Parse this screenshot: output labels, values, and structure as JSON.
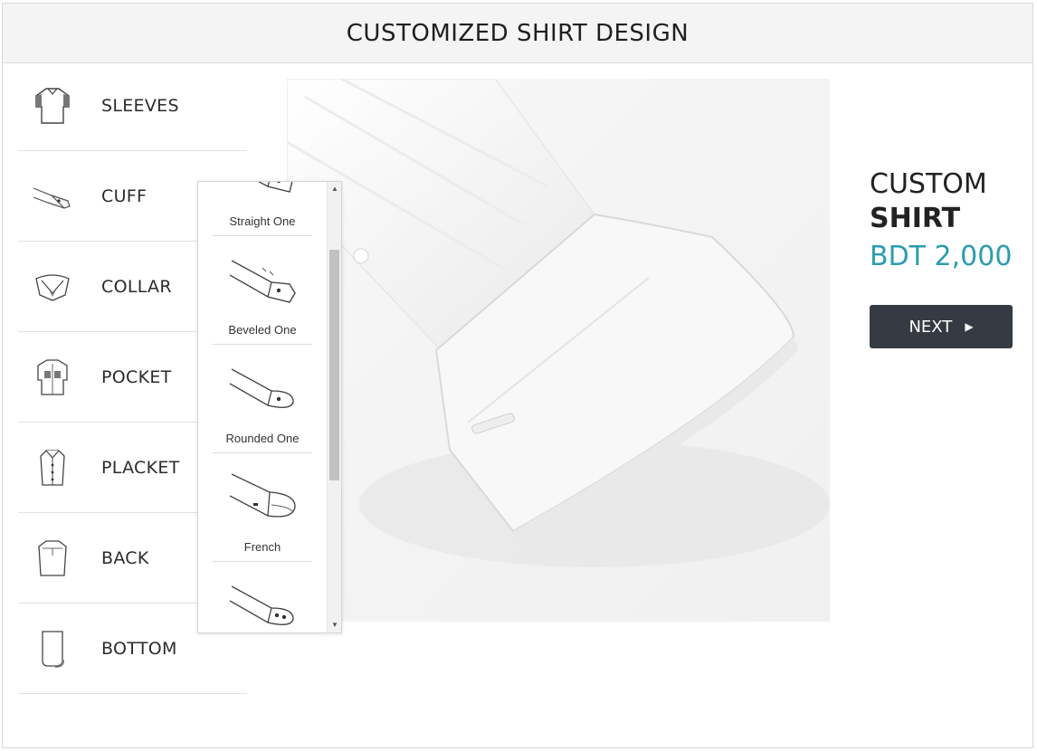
{
  "header": {
    "title": "CUSTOMIZED SHIRT DESIGN"
  },
  "menu": {
    "items": [
      {
        "label": "SLEEVES",
        "icon": "sleeves-icon"
      },
      {
        "label": "CUFF",
        "icon": "cuff-icon"
      },
      {
        "label": "COLLAR",
        "icon": "collar-icon"
      },
      {
        "label": "POCKET",
        "icon": "pocket-icon"
      },
      {
        "label": "PLACKET",
        "icon": "placket-icon"
      },
      {
        "label": "BACK",
        "icon": "back-icon"
      },
      {
        "label": "BOTTOM",
        "icon": "bottom-icon"
      }
    ]
  },
  "cuff_options": {
    "items": [
      {
        "label": "Straight One",
        "icon": "straight-cuff-icon"
      },
      {
        "label": "Beveled One",
        "icon": "beveled-cuff-icon"
      },
      {
        "label": "Rounded One",
        "icon": "rounded-cuff-icon"
      },
      {
        "label": "French",
        "icon": "french-cuff-icon"
      },
      {
        "label": "",
        "icon": "double-button-cuff-icon"
      }
    ]
  },
  "product": {
    "title_line1": "CUSTOM",
    "title_line2": "SHIRT",
    "price": "BDT 2,000",
    "next_label": "NEXT"
  },
  "colors": {
    "accent": "#2a9db0",
    "button": "#363a42"
  }
}
